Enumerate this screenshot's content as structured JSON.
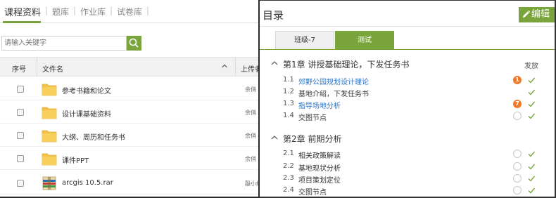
{
  "library": {
    "tabs": [
      {
        "label": "课程资料",
        "active": true
      },
      {
        "label": "题库",
        "active": false
      },
      {
        "label": "作业库",
        "active": false
      },
      {
        "label": "试卷库",
        "active": false
      }
    ],
    "search": {
      "placeholder": "请输入关键字"
    },
    "columns": {
      "index": "序号",
      "file_name": "文件名",
      "uploader": "上传者"
    },
    "files": [
      {
        "name": "参考书籍和论文",
        "type": "folder",
        "uploader": "余俏"
      },
      {
        "name": "设计课基础资料",
        "type": "folder",
        "uploader": "余俏"
      },
      {
        "name": "大纲、周历和任务书",
        "type": "folder",
        "uploader": "余俏"
      },
      {
        "name": "课件PPT",
        "type": "folder",
        "uploader": "余俏"
      },
      {
        "name": "arcgis 10.5.rar",
        "type": "rar",
        "uploader": "殷小红"
      }
    ],
    "accent": "#79a53c"
  },
  "catalog": {
    "title": "目录",
    "edit_label": "编辑",
    "class_tabs": [
      {
        "label": "班级-7",
        "active": false
      },
      {
        "label": "测试",
        "active": true
      }
    ],
    "release_label": "发放",
    "chapters": [
      {
        "title": "第1章 讲授基础理论，下发任务书",
        "sections": [
          {
            "num": "1.1",
            "title": "郊野公园规划设计理论",
            "link": true,
            "badge": "1",
            "released": true
          },
          {
            "num": "1.2",
            "title": "基地介绍，下发任务书",
            "link": false,
            "badge": "",
            "released": true
          },
          {
            "num": "1.3",
            "title": "指导场地分析",
            "link": true,
            "badge": "7",
            "released": true
          },
          {
            "num": "1.4",
            "title": "交图节点",
            "link": false,
            "badge": "",
            "released": true
          }
        ]
      },
      {
        "title": "第2章 前期分析",
        "sections": [
          {
            "num": "2.1",
            "title": "相关政策解读",
            "link": false,
            "badge": "",
            "released": true
          },
          {
            "num": "2.2",
            "title": "基地现状分析",
            "link": false,
            "badge": "",
            "released": true
          },
          {
            "num": "2.3",
            "title": "项目策划定位",
            "link": false,
            "badge": "",
            "released": true
          },
          {
            "num": "2.4",
            "title": "交图节点",
            "link": false,
            "badge": "",
            "released": true
          }
        ]
      }
    ],
    "badge_color": "#f07a2a",
    "link_color": "#2b72c2"
  }
}
